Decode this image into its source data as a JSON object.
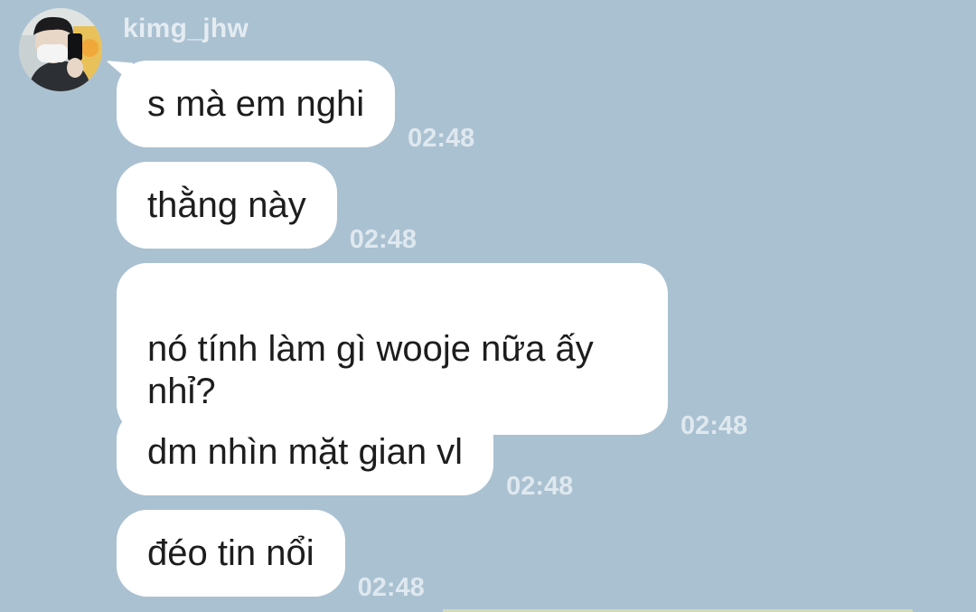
{
  "conversation": {
    "sender": "kimg_jhw",
    "messages": [
      {
        "text": "s mà em nghi",
        "time": "02:48"
      },
      {
        "text": "thằng này",
        "time": "02:48"
      },
      {
        "text": "nó tính làm gì wooje nữa ấy\nnhỉ?",
        "time": "02:48"
      },
      {
        "text": "dm nhìn mặt gian vl",
        "time": "02:48"
      },
      {
        "text": "đéo tin nổi",
        "time": "02:48"
      }
    ]
  },
  "colors": {
    "background": "#aac1d1",
    "bubble": "#ffffff",
    "timestamp": "#dfe8ef",
    "sender_name": "#e4ecf2"
  },
  "icons": {
    "avatar": "profile-photo"
  }
}
